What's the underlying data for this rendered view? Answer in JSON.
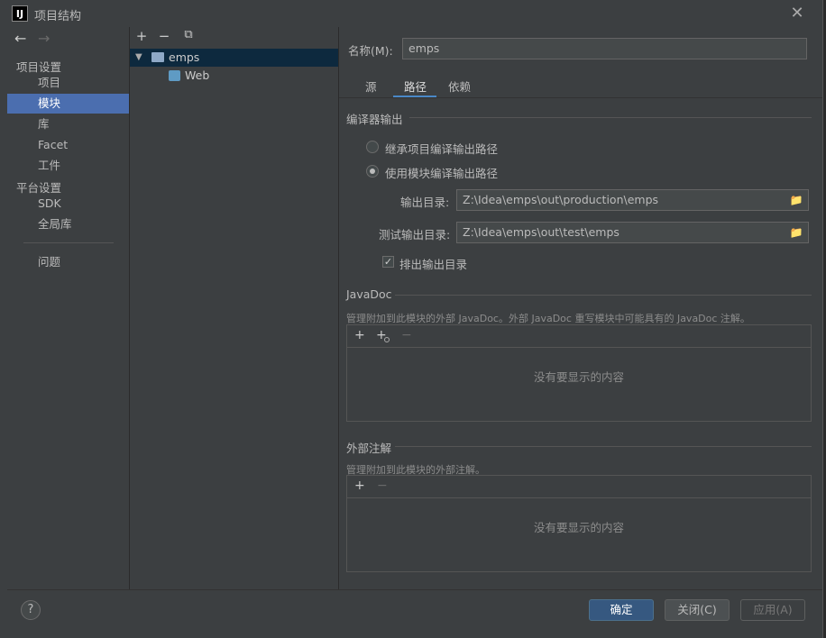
{
  "window": {
    "title": "项目结构",
    "app_icon": "IJ"
  },
  "nav": {
    "back": "←",
    "forward": "→",
    "section_project": "项目设置",
    "items_project": [
      "项目",
      "模块",
      "库",
      "Facet",
      "工件"
    ],
    "section_platform": "平台设置",
    "items_platform": [
      "SDK",
      "全局库"
    ],
    "problems": "问题",
    "selected": "模块"
  },
  "tree": {
    "toolbar": {
      "add": "+",
      "remove": "−",
      "copy": "⧉"
    },
    "root": "emps",
    "child": "Web"
  },
  "module": {
    "name_label": "名称(M):",
    "name_value": "emps",
    "tabs": [
      "源",
      "路径",
      "依赖"
    ],
    "active_tab": "路径"
  },
  "compiler": {
    "title": "编译器输出",
    "radio_inherit": "继承项目编译输出路径",
    "radio_use_module": "使用模块编译输出路径",
    "selected_radio": "使用模块编译输出路径",
    "output_label": "输出目录:",
    "output_value": "Z:\\Idea\\emps\\out\\production\\emps",
    "test_output_label": "测试输出目录:",
    "test_output_value": "Z:\\Idea\\emps\\out\\test\\emps",
    "exclude_label": "排出输出目录",
    "exclude_checked": true
  },
  "javadoc": {
    "title": "JavaDoc",
    "hint": "管理附加到此模块的外部 JavaDoc。外部 JavaDoc 重写模块中可能具有的 JavaDoc 注解。",
    "empty": "没有要显示的内容",
    "toolbar": {
      "add": "+",
      "add_url": "+",
      "remove": "−"
    }
  },
  "annotations": {
    "title": "外部注解",
    "hint": "管理附加到此模块的外部注解。",
    "empty": "没有要显示的内容",
    "toolbar": {
      "add": "+",
      "remove": "−"
    }
  },
  "footer": {
    "help": "?",
    "ok": "确定",
    "close": "关闭(C)",
    "apply": "应用(A)"
  },
  "colors": {
    "background": "#3c3f41",
    "selection": "#4b6eaf",
    "accent_tab": "#4a88c7",
    "primary_button": "#365880"
  }
}
